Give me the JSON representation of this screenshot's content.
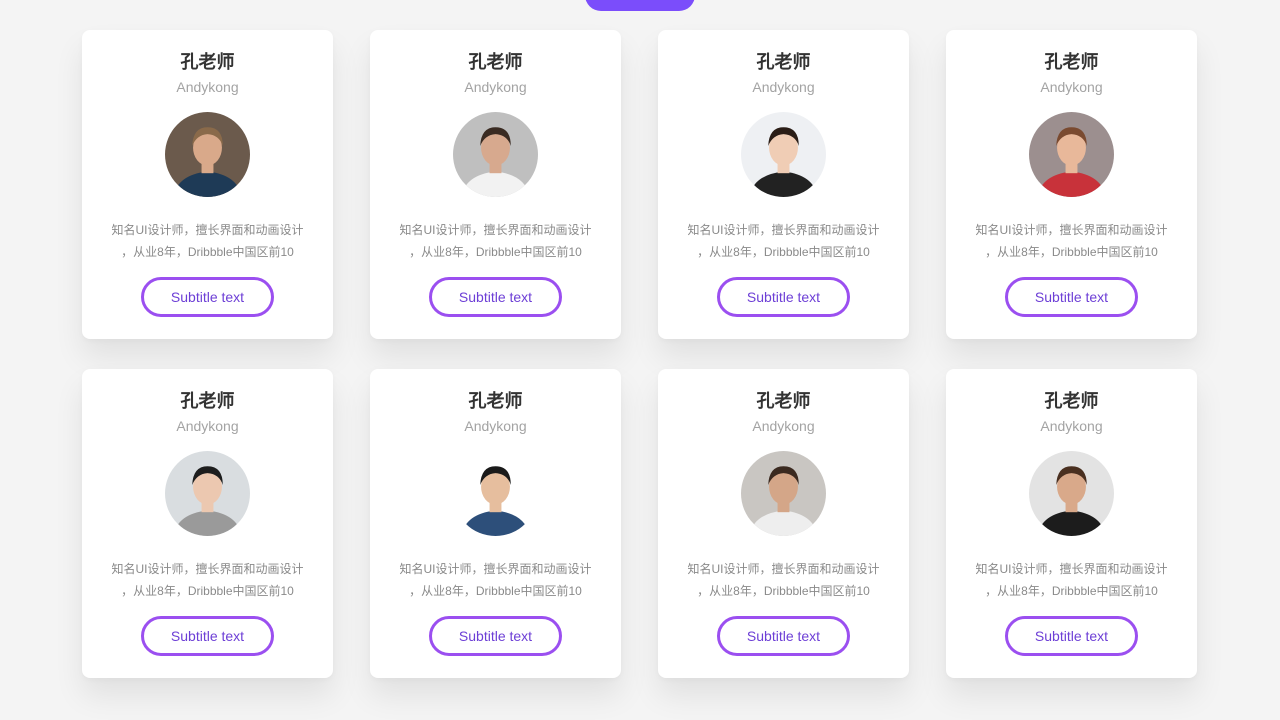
{
  "cards": [
    {
      "name": "孔老师",
      "handle": "Andykong",
      "desc_line1": "知名UI设计师，擅长界面和动画设计",
      "desc_line2": "，从业8年，Dribbble中国区前10",
      "button": "Subtitle text",
      "avatar": {
        "bg": "#6b5a4c",
        "skin": "#d9a98a",
        "hair": "#8a6a4a",
        "shirt": "#1e3a56"
      }
    },
    {
      "name": "孔老师",
      "handle": "Andykong",
      "desc_line1": "知名UI设计师，擅长界面和动画设计",
      "desc_line2": "，从业8年，Dribbble中国区前10",
      "button": "Subtitle text",
      "avatar": {
        "bg": "#bfbfbf",
        "skin": "#d7a98e",
        "hair": "#3a2b22",
        "shirt": "#f2f2f2"
      }
    },
    {
      "name": "孔老师",
      "handle": "Andykong",
      "desc_line1": "知名UI设计师，擅长界面和动画设计",
      "desc_line2": "，从业8年，Dribbble中国区前10",
      "button": "Subtitle text",
      "avatar": {
        "bg": "#eef0f3",
        "skin": "#f0cdb5",
        "hair": "#2a1d16",
        "shirt": "#222222"
      }
    },
    {
      "name": "孔老师",
      "handle": "Andykong",
      "desc_line1": "知名UI设计师，擅长界面和动画设计",
      "desc_line2": "，从业8年，Dribbble中国区前10",
      "button": "Subtitle text",
      "avatar": {
        "bg": "#9c8f8f",
        "skin": "#e8b89a",
        "hair": "#7a4a30",
        "shirt": "#c8323a"
      }
    },
    {
      "name": "孔老师",
      "handle": "Andykong",
      "desc_line1": "知名UI设计师，擅长界面和动画设计",
      "desc_line2": "，从业8年，Dribbble中国区前10",
      "button": "Subtitle text",
      "avatar": {
        "bg": "#d9dde0",
        "skin": "#ecc8b0",
        "hair": "#1d1d1d",
        "shirt": "#9a9a9a"
      }
    },
    {
      "name": "孔老师",
      "handle": "Andykong",
      "desc_line1": "知名UI设计师，擅长界面和动画设计",
      "desc_line2": "，从业8年，Dribbble中国区前10",
      "button": "Subtitle text",
      "avatar": {
        "bg": "#ffffff",
        "skin": "#e6be9e",
        "hair": "#1a1a1a",
        "shirt": "#2d4f7a"
      }
    },
    {
      "name": "孔老师",
      "handle": "Andykong",
      "desc_line1": "知名UI设计师，擅长界面和动画设计",
      "desc_line2": "，从业8年，Dribbble中国区前10",
      "button": "Subtitle text",
      "avatar": {
        "bg": "#c9c6c2",
        "skin": "#d4a688",
        "hair": "#3b2a20",
        "shirt": "#eeeeee"
      }
    },
    {
      "name": "孔老师",
      "handle": "Andykong",
      "desc_line1": "知名UI设计师，擅长界面和动画设计",
      "desc_line2": "，从业8年，Dribbble中国区前10",
      "button": "Subtitle text",
      "avatar": {
        "bg": "#e3e3e3",
        "skin": "#d9a98a",
        "hair": "#4a3020",
        "shirt": "#1c1c1c"
      }
    }
  ],
  "colors": {
    "accent": "#7b4dfb",
    "button_border": "#9b4ff0",
    "button_text": "#6d3fd6"
  },
  "icons": {
    "avatar": "person-photo-icon"
  }
}
